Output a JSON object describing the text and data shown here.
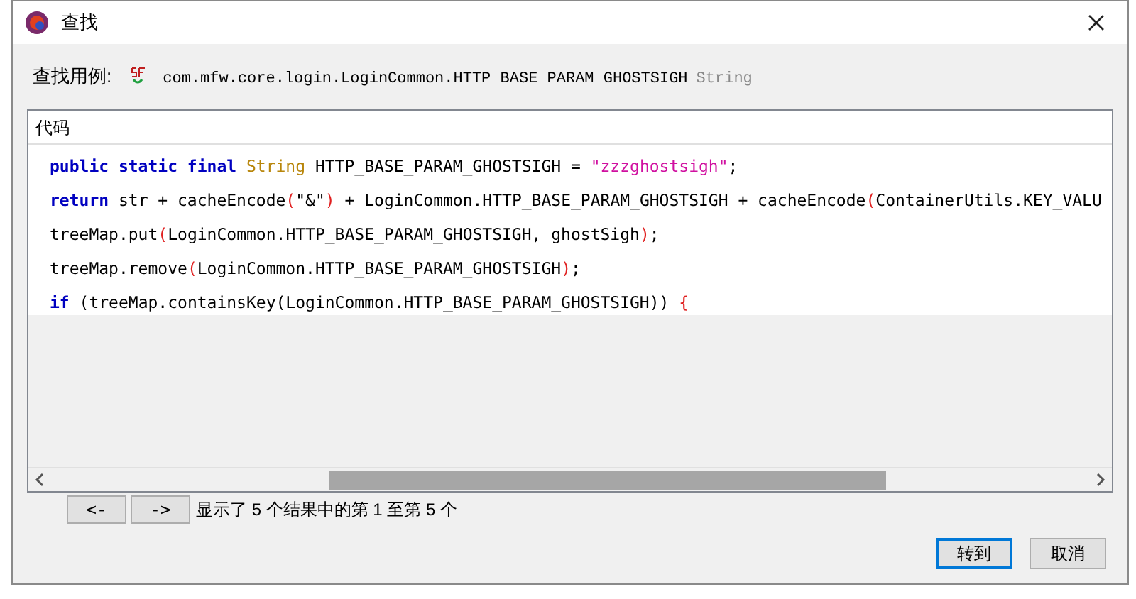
{
  "window": {
    "title": "查找"
  },
  "usage": {
    "label": "查找用例:",
    "symbol": "com.mfw.core.login.LoginCommon.HTTP BASE PARAM GHOSTSIGH",
    "type": "String"
  },
  "code_panel": {
    "header": "代码",
    "lines": [
      {
        "tokens": [
          {
            "kind": "keyword",
            "text": "public static final "
          },
          {
            "kind": "type",
            "text": "String "
          },
          {
            "kind": "plain",
            "text": "HTTP_BASE_PARAM_GHOSTSIGH = "
          },
          {
            "kind": "string",
            "text": "\"zzzghostsigh\""
          },
          {
            "kind": "plain",
            "text": ";"
          }
        ]
      },
      {
        "tokens": [
          {
            "kind": "keyword",
            "text": "return "
          },
          {
            "kind": "plain",
            "text": "str + cacheEncode"
          },
          {
            "kind": "paren",
            "text": "("
          },
          {
            "kind": "plain",
            "text": "\"&\""
          },
          {
            "kind": "paren",
            "text": ")"
          },
          {
            "kind": "plain",
            "text": " + LoginCommon.HTTP_BASE_PARAM_GHOSTSIGH + cacheEncode"
          },
          {
            "kind": "paren",
            "text": "("
          },
          {
            "kind": "plain",
            "text": "ContainerUtils.KEY_VALU"
          }
        ]
      },
      {
        "tokens": [
          {
            "kind": "plain",
            "text": "treeMap.put"
          },
          {
            "kind": "paren",
            "text": "("
          },
          {
            "kind": "plain",
            "text": "LoginCommon.HTTP_BASE_PARAM_GHOSTSIGH, ghostSigh"
          },
          {
            "kind": "paren",
            "text": ")"
          },
          {
            "kind": "plain",
            "text": ";"
          }
        ]
      },
      {
        "tokens": [
          {
            "kind": "plain",
            "text": "treeMap.remove"
          },
          {
            "kind": "paren",
            "text": "("
          },
          {
            "kind": "plain",
            "text": "LoginCommon.HTTP_BASE_PARAM_GHOSTSIGH"
          },
          {
            "kind": "paren",
            "text": ")"
          },
          {
            "kind": "plain",
            "text": ";"
          }
        ]
      },
      {
        "tokens": [
          {
            "kind": "keyword",
            "text": "if "
          },
          {
            "kind": "plain",
            "text": "(treeMap.containsKey(LoginCommon.HTTP_BASE_PARAM_GHOSTSIGH)) "
          },
          {
            "kind": "paren",
            "text": "{"
          }
        ]
      }
    ]
  },
  "pager": {
    "prev": "<-",
    "next": "->",
    "status": "显示了 5 个结果中的第 1 至第 5 个"
  },
  "buttons": [
    {
      "label": "转到",
      "selected": true
    },
    {
      "label": "取消",
      "selected": false
    }
  ]
}
